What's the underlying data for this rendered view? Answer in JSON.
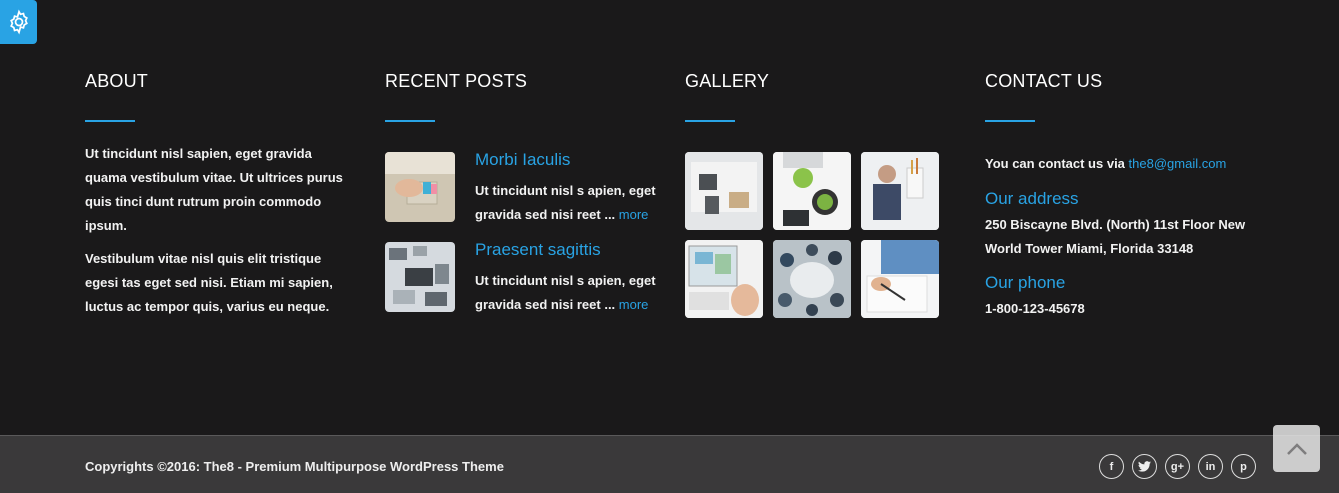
{
  "about": {
    "title": "ABOUT",
    "paragraphs": [
      "Ut tincidunt nisl sapien, eget gravida quama vestibulum vitae. Ut ultrices purus quis tinci dunt rutrum proin commodo ipsum.",
      "Vestibulum vitae nisl quis elit tristique egesi tas eget sed nisi. Etiam mi sapien, luctus ac tempor quis, varius eu neque."
    ]
  },
  "recent_posts": {
    "title": "RECENT POSTS",
    "posts": [
      {
        "title": "Morbi Iaculis",
        "excerpt": "Ut tincidunt nisl s apien, eget gravida sed nisi reet ...",
        "more": "more"
      },
      {
        "title": "Praesent sagittis",
        "excerpt": "Ut tincidunt nisl s apien, eget gravida sed nisi reet ...",
        "more": "more"
      }
    ]
  },
  "gallery": {
    "title": "GALLERY",
    "items": [
      "office-desk-photo",
      "laptop-apple-photo",
      "businessman-photo",
      "monitor-stylus-photo",
      "meeting-table-photo",
      "writing-photo"
    ]
  },
  "contact": {
    "title": "CONTACT US",
    "intro": "You can contact us via",
    "email": "the8@gmail.com",
    "address_label": "Our address",
    "address_line1": "250 Biscayne Blvd. (North) 11st Floor New",
    "address_line2": "World Tower Miami, Florida 33148",
    "phone_label": "Our phone",
    "phone": "1-800-123-45678"
  },
  "footer": {
    "copyright": "Copyrights ©2016: The8 - Premium Multipurpose WordPress Theme",
    "socials": [
      "f",
      "t",
      "g+",
      "in",
      "p"
    ]
  },
  "colors": {
    "accent": "#29a3e4",
    "background": "#1a191a",
    "bottom_bar": "#3a393a"
  }
}
